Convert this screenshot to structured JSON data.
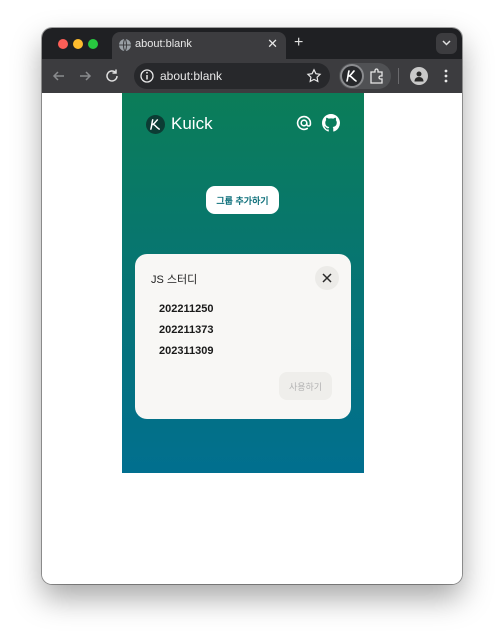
{
  "browser": {
    "tab_title": "about:blank",
    "address": "about:blank"
  },
  "extension": {
    "brand": "Kuick",
    "add_group_label": "그룹 추가하기",
    "group": {
      "title": "JS 스터디",
      "members": [
        "202211250",
        "202211373",
        "202311309"
      ],
      "use_label": "사용하기"
    }
  },
  "icons": [
    "globe-icon",
    "close-icon",
    "new-tab-icon",
    "back-icon",
    "forward-icon",
    "reload-icon",
    "info-icon",
    "star-icon",
    "kuick-extension-icon",
    "puzzle-icon",
    "profile-icon",
    "kebab-icon",
    "at-icon",
    "github-icon"
  ],
  "colors": {
    "gradient_top": "#0b7d58",
    "gradient_bottom": "#016f8f",
    "card": "#f8f7f5",
    "button_text": "#0b6e79"
  }
}
